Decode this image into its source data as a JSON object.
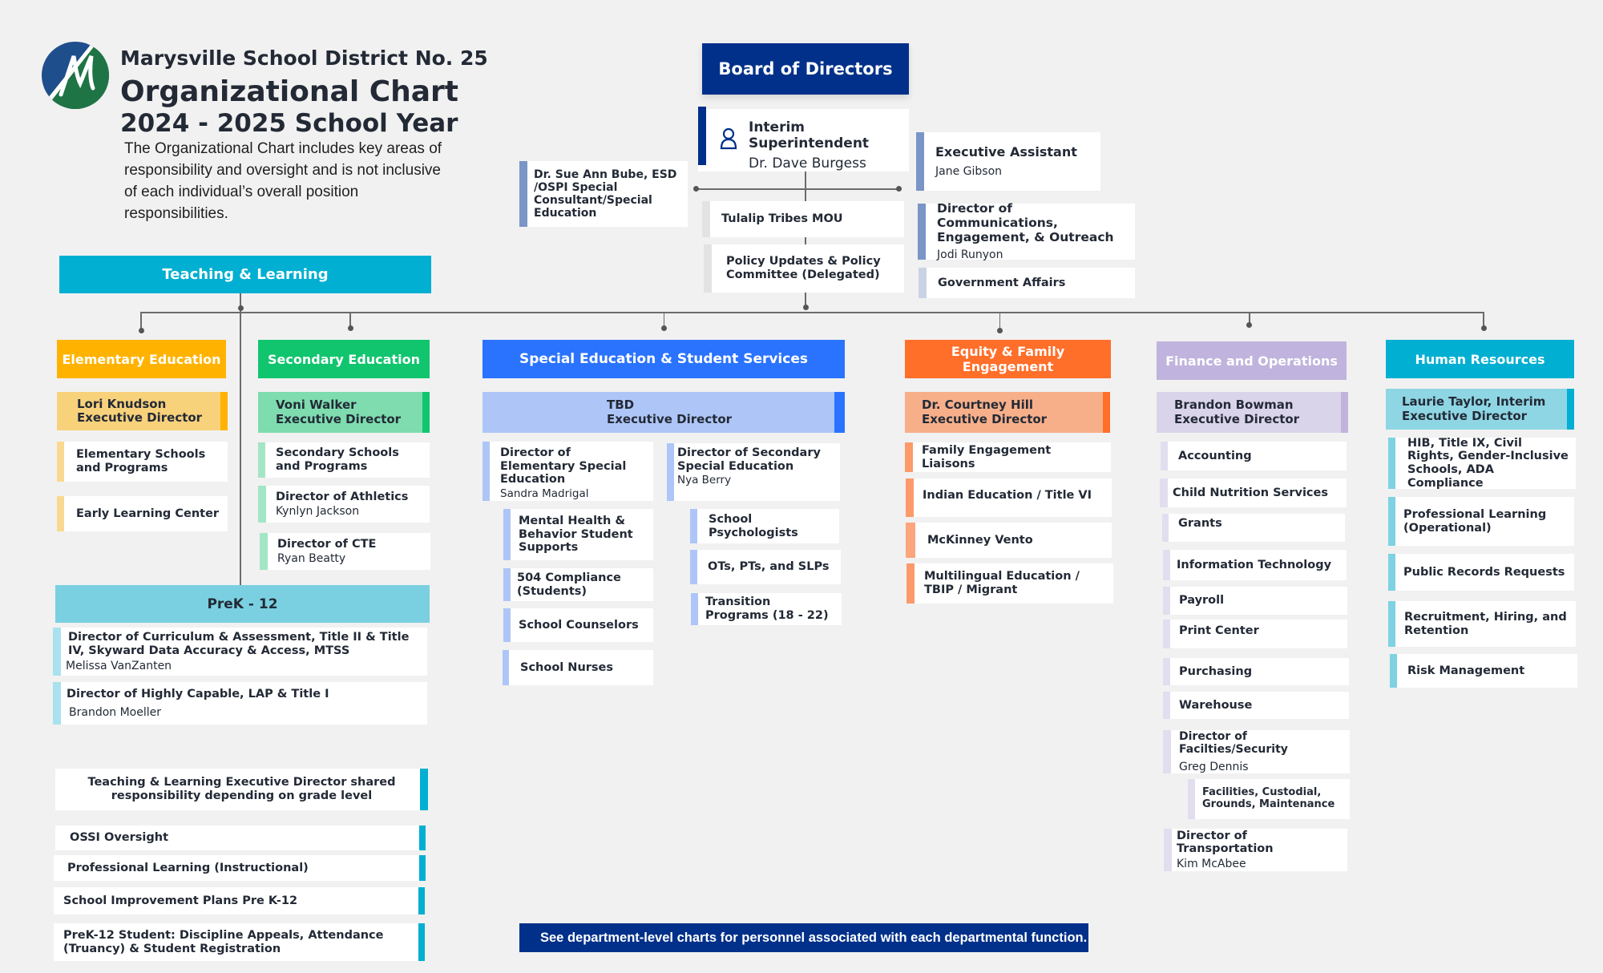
{
  "header": {
    "org_name": "Marysville School District No. 25",
    "title": "Organizational Chart",
    "school_year": "2024 - 2025 School Year",
    "intro": "The Organizational Chart includes key areas of responsibility and oversight and is not inclusive of each individual’s overall position responsibilities.",
    "logo_icon": "district-m-logo"
  },
  "colors": {
    "navy": "#00308A",
    "teaching_learning": "#00AFD1",
    "elementary": "#FFB300",
    "secondary": "#11C56E",
    "special_ed": "#2A73FF",
    "equity": "#FF6F2A",
    "finance": "#C0B3DD",
    "human_resources": "#00AFD1",
    "prek12": "#7AD0E0"
  },
  "top": {
    "board": "Board of Directors",
    "superintendent": {
      "title": "Interim Superintendent",
      "name": "Dr. Dave Burgess",
      "icon": "person-icon"
    },
    "consultant": "Dr. Sue Ann Bube, ESD /OSPI Special Consultant/Special Education",
    "tulalip": "Tulalip Tribes MOU",
    "policy": "Policy Updates & Policy Committee (Delegated)",
    "exec_assistant": {
      "title": "Executive Assistant",
      "name": "Jane Gibson"
    },
    "communications": {
      "title": "Director of Communications, Engagement, & Outreach",
      "name": "Jodi Runyon"
    },
    "gov_affairs": "Government Affairs"
  },
  "teaching_learning": {
    "header": "Teaching & Learning",
    "elementary": {
      "header": "Elementary Education",
      "exec": [
        "Lori Knudson",
        "Executive Director"
      ],
      "items": [
        {
          "title": "Elementary Schools and Programs"
        },
        {
          "title": "Early Learning Center"
        }
      ]
    },
    "secondary": {
      "header": "Secondary Education",
      "exec": [
        "Voni Walker",
        "Executive Director"
      ],
      "items": [
        {
          "title": "Secondary Schools and Programs"
        },
        {
          "title": "Director of Athletics",
          "name": "Kynlyn Jackson"
        },
        {
          "title": "Director of CTE",
          "name": "Ryan Beatty"
        }
      ]
    },
    "prek12": {
      "header": "PreK - 12",
      "items": [
        {
          "title": "Director of Curriculum & Assessment, Title II & Title IV, Skyward Data Accuracy & Access, MTSS",
          "name": "Melissa VanZanten"
        },
        {
          "title": "Director of Highly Capable, LAP & Title I",
          "name": "Brandon Moeller"
        }
      ]
    },
    "shared": {
      "note": "Teaching & Learning Executive Director shared responsibility depending on grade level",
      "items": [
        "OSSI Oversight",
        "Professional Learning (Instructional)",
        "School Improvement Plans Pre K-12",
        "PreK-12 Student: Discipline Appeals, Attendance (Truancy) & Student Registration"
      ]
    }
  },
  "special_ed": {
    "header": "Special Education & Student Services",
    "exec": [
      "TBD",
      "Executive Director"
    ],
    "elem_director": {
      "title": "Director of Elementary Special Education",
      "name": "Sandra Madrigal"
    },
    "sec_director": {
      "title": "Director of Secondary Special Education",
      "name": "Nya Berry"
    },
    "elem_items": [
      "Mental Health & Behavior Student Supports",
      "504 Compliance (Students)",
      "School Counselors",
      "School Nurses"
    ],
    "sec_items": [
      "School Psychologists",
      "OTs, PTs, and SLPs",
      "Transition Programs (18 - 22)"
    ]
  },
  "equity": {
    "header": "Equity & Family Engagement",
    "exec": [
      "Dr. Courtney Hill",
      "Executive Director"
    ],
    "items": [
      "Family Engagement Liaisons",
      "Indian Education / Title VI",
      "McKinney Vento",
      "Multilingual Education / TBIP / Migrant"
    ]
  },
  "finance": {
    "header": "Finance and Operations",
    "exec": [
      "Brandon Bowman",
      "Executive Director"
    ],
    "items": [
      {
        "title": "Accounting"
      },
      {
        "title": "Child Nutrition Services"
      },
      {
        "title": "Grants"
      },
      {
        "title": "Information Technology"
      },
      {
        "title": "Payroll"
      },
      {
        "title": "Print Center"
      },
      {
        "title": "Purchasing"
      },
      {
        "title": "Warehouse"
      },
      {
        "title": "Director of Facilties/Security",
        "name": "Greg Dennis"
      },
      {
        "title": "Facilities, Custodial, Grounds, Maintenance"
      },
      {
        "title": "Director of Transportation",
        "name": "Kim McAbee"
      }
    ]
  },
  "hr": {
    "header": "Human Resources",
    "exec": [
      "Laurie Taylor, Interim",
      "Executive Director"
    ],
    "items": [
      "HIB, Title IX, Civil Rights, Gender-Inclusive Schools, ADA Compliance",
      "Professional Learning (Operational)",
      "Public Records Requests",
      "Recruitment, Hiring, and Retention",
      "Risk Management"
    ]
  },
  "footer": "See department-level charts for personnel associated with each departmental function."
}
